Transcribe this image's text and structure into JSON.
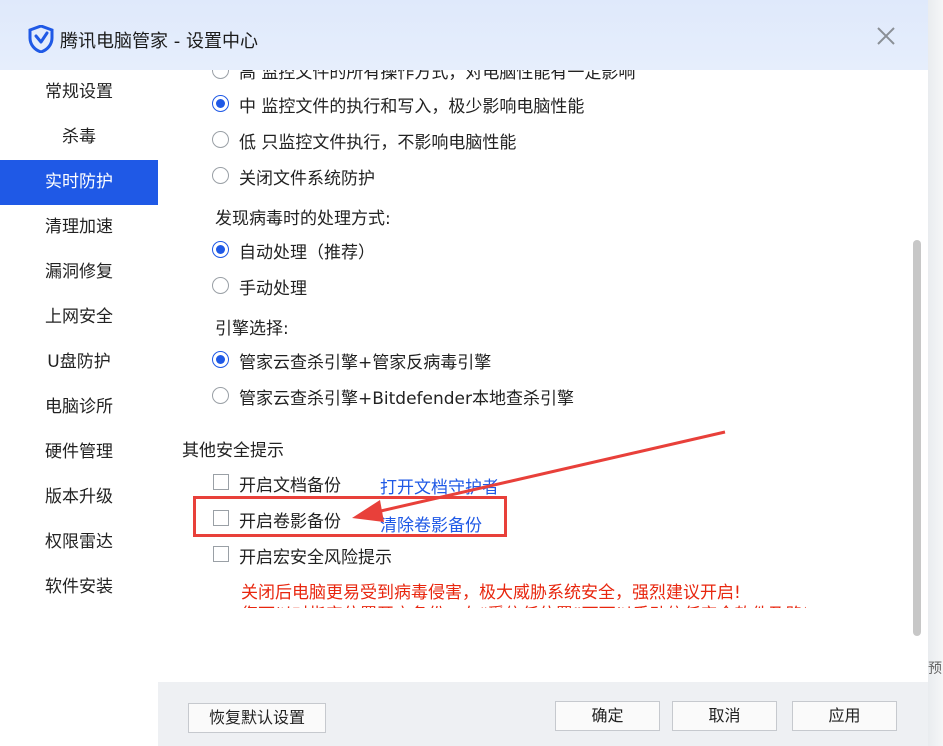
{
  "window": {
    "title": "腾讯电脑管家 - 设置中心",
    "close_label": "×",
    "icons": {
      "logo": "shield-logo-icon",
      "close": "close-icon"
    },
    "colors": {
      "accent": "#1f59e6",
      "warning": "#e8260e",
      "annotation": "#e8403a"
    }
  },
  "sidebar": {
    "items": [
      {
        "label": "常规设置",
        "active": false
      },
      {
        "label": "杀毒",
        "active": false
      },
      {
        "label": "实时防护",
        "active": true
      },
      {
        "label": "清理加速",
        "active": false
      },
      {
        "label": "漏洞修复",
        "active": false
      },
      {
        "label": "上网安全",
        "active": false
      },
      {
        "label": "U盘防护",
        "active": false
      },
      {
        "label": "电脑诊所",
        "active": false
      },
      {
        "label": "硬件管理",
        "active": false
      },
      {
        "label": "版本升级",
        "active": false
      },
      {
        "label": "权限雷达",
        "active": false
      },
      {
        "label": "软件安装",
        "active": false
      }
    ]
  },
  "file_protection": {
    "cut_off_option": "高   监控文件的所有操作方式，对电脑性能有一定影响",
    "options": [
      {
        "label": "中    监控文件的执行和写入，极少影响电脑性能",
        "checked": true
      },
      {
        "label": "低    只监控文件执行，不影响电脑性能",
        "checked": false
      },
      {
        "label": "关闭文件系统防护",
        "checked": false
      }
    ]
  },
  "virus_handling": {
    "heading": "发现病毒时的处理方式:",
    "options": [
      {
        "label": "自动处理（推荐）",
        "checked": true
      },
      {
        "label": "手动处理",
        "checked": false
      }
    ]
  },
  "engine": {
    "heading": "引擎选择:",
    "options": [
      {
        "label": "管家云查杀引擎+管家反病毒引擎",
        "checked": true
      },
      {
        "label": "管家云查杀引擎+Bitdefender本地查杀引擎",
        "checked": false
      }
    ]
  },
  "other_security": {
    "heading": "其他安全提示",
    "items": [
      {
        "label": "开启文档备份",
        "checked": false,
        "link": "打开文档守护者"
      },
      {
        "label": "开启卷影备份",
        "checked": false,
        "link": "清除卷影备份"
      },
      {
        "label": "开启宏安全风险提示",
        "checked": false,
        "link": ""
      }
    ],
    "warning": "关闭后电脑更易受到病毒侵害，极大威胁系统安全，强烈建议开启!",
    "warning_cut": "您可以对指定位置开启备份，在“受信任位置”下可以手动信任安全软件及路径"
  },
  "footer": {
    "restore_label": "恢复默认设置",
    "ok_label": "确定",
    "cancel_label": "取消",
    "apply_label": "应用"
  },
  "background_fragment": "预"
}
